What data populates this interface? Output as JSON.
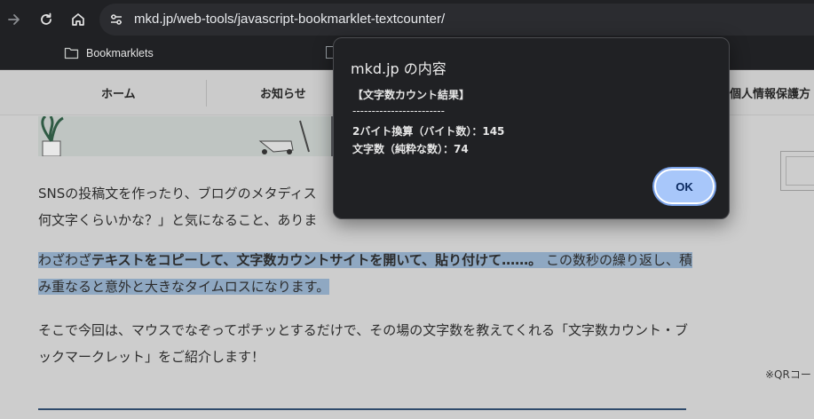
{
  "browser": {
    "url": "mkd.jp/web-tools/javascript-bookmarklet-textcounter/",
    "bookmarks": [
      {
        "label": "Bookmarklets",
        "icon": "folder-icon"
      }
    ]
  },
  "site_nav": {
    "items": [
      "ホーム",
      "お知らせ",
      "個人情報保護方"
    ]
  },
  "article": {
    "p1_line1": "SNSの投稿文を作ったり、ブログのメタディス",
    "p1_line2": "何文字くらいかな？」と気になること、ありま",
    "p2_start": "わざわざ",
    "p2_bold": "テキストをコピーして、文字数カウントサイトを開いて、貼り付けて……。",
    "p2_end": " この数秒の繰り返し、積み重なると意外と大きなタイムロスになります。",
    "p3": "そこで今回は、マウスでなぞってポチッとするだけで、その場の文字数を教えてくれる「文字数カウント・ブックマークレット」をご紹介します！",
    "side_note": "※QRコー"
  },
  "dialog": {
    "title": "mkd.jp の内容",
    "line1": "【文字数カウント結果】",
    "divider": "------------------------",
    "line2": "2バイト換算（バイト数）：145",
    "line3": "文字数（純粋な数）：74",
    "ok_label": "OK"
  },
  "colors": {
    "dialog_bg": "#202124",
    "ok_button": "#a8c7fa",
    "highlight": "#8fa8c2"
  }
}
